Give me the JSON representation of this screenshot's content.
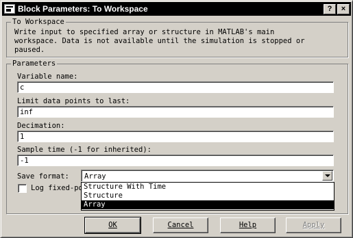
{
  "window": {
    "title": "Block Parameters: To Workspace",
    "help_button": "?",
    "close_button": "×"
  },
  "description_group": {
    "legend": "To Workspace",
    "text": "Write input to specified array or structure in MATLAB's main\nworkspace. Data is not available until the simulation is stopped or\npaused."
  },
  "parameters": {
    "legend": "Parameters",
    "variable_name_label": "Variable name:",
    "variable_name_value": "c",
    "limit_label": "Limit data points to last:",
    "limit_value": "inf",
    "decimation_label": "Decimation:",
    "decimation_value": "1",
    "sample_time_label": "Sample time (-1 for inherited):",
    "sample_time_value": "-1",
    "save_format_label": "Save format:",
    "save_format_value": "Array",
    "save_format_options": [
      "Structure With Time",
      "Structure",
      "Array"
    ],
    "log_fixed_label": "Log fixed-point data as a fi object",
    "log_fixed_checked": false
  },
  "buttons": {
    "ok": "OK",
    "cancel": "Cancel",
    "help": "Help",
    "apply": "Apply"
  }
}
